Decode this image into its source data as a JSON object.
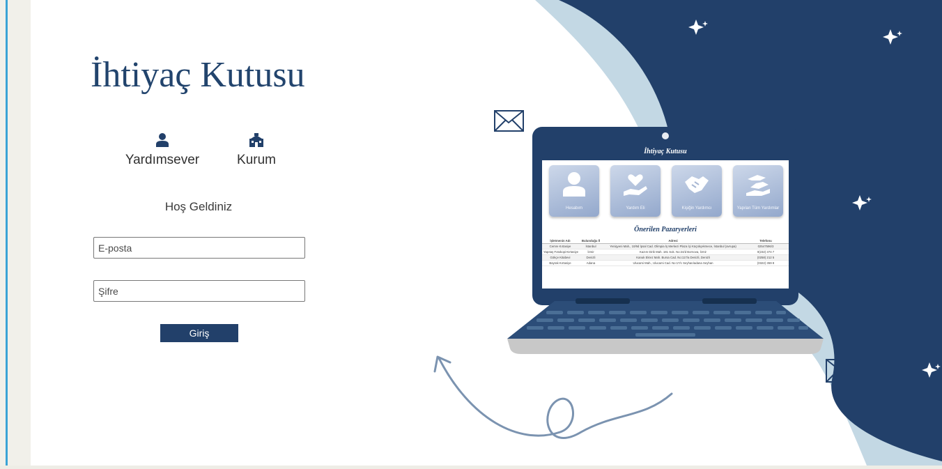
{
  "app": {
    "title": "İhtiyaç Kutusu"
  },
  "roles": [
    {
      "label": "Yardımsever",
      "icon": "user-icon"
    },
    {
      "label": "Kurum",
      "icon": "institution-icon"
    }
  ],
  "login": {
    "welcome": "Hoş Geldiniz",
    "email_placeholder": "E-posta",
    "password_placeholder": "Şifre",
    "submit_label": "Giriş"
  },
  "illustration": {
    "screen_title": "İhtiyaç Kutusu",
    "cards": [
      "Hesabım",
      "Yardım Eli",
      "Kişiğin Yardımcı",
      "Yapılan Tüm Yardımlar"
    ],
    "subtitle": "Önerilen Pazaryerleri",
    "table": {
      "headers": [
        "İşletmenin Adı",
        "Bulunduğu İl",
        "Adresi",
        "Telefonu"
      ],
      "rows": [
        [
          "Cemre Kırtasiye",
          "İstanbul",
          "Yenişyeni Mah., 10/9d İpsal Cad. Olimpia İş Merkezi Plaza İçi Küçükçekmece, İstanbul (avrupa)",
          "02547596/3"
        ],
        [
          "Yapıtaş Fotokopi-Kırtasiye",
          "İzmir",
          "Kazım Dirik Mah. 181 Sok. No:24/d Bornova, İzmir",
          "0(232) 374 7"
        ],
        [
          "Gökçe Kitabevi",
          "Denizli",
          "Kanuk Ekrez Mah. Bursa Cad. No:117/a Denizli, Denizli",
          "(0258) 212 5"
        ],
        [
          "Bayrak Kırtasiye",
          "Adana",
          "Ulucami Mah., Ulucami Cad. No:17/c Seyhan/adana Seyhan",
          "(0322) 359 8"
        ]
      ]
    }
  },
  "colors": {
    "brand_navy": "#22406a",
    "light_blue": "#c3d8e4",
    "arrow_blue": "#7b93b0"
  },
  "icons": {
    "sparkles": "sparkles-icon",
    "mail": "mail-icon",
    "arrow": "curved-arrow-icon"
  }
}
